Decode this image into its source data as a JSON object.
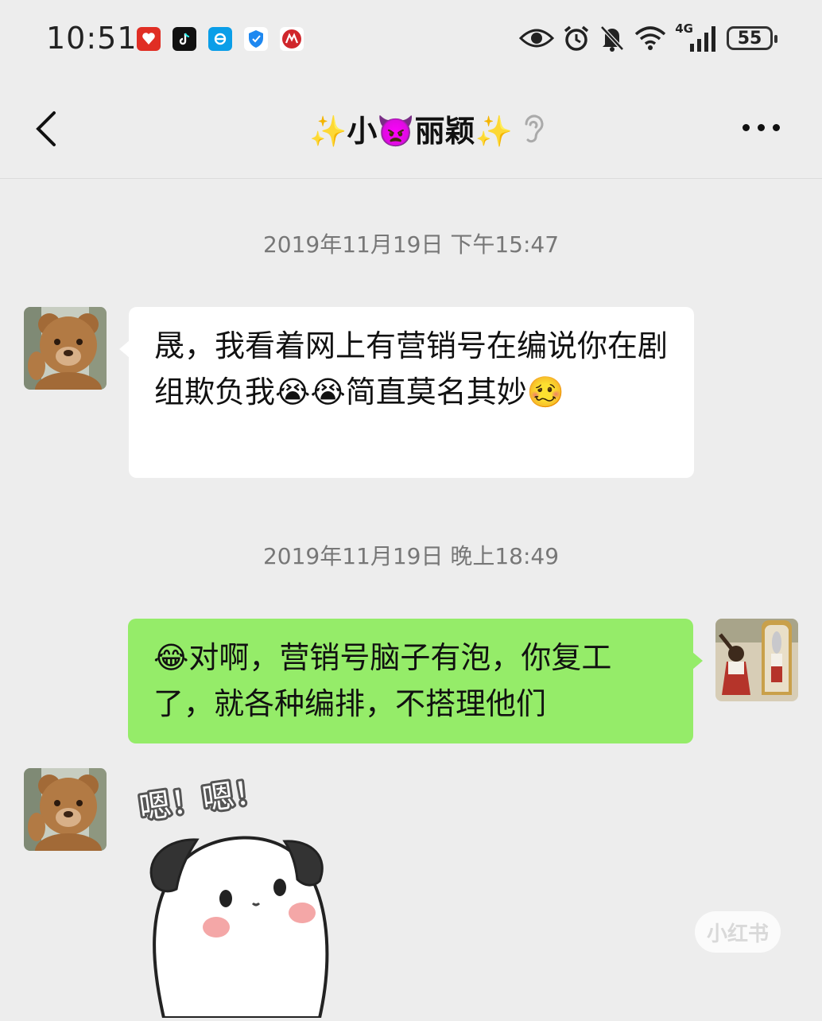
{
  "status_bar": {
    "time": "10:51",
    "network": "4G",
    "battery": "55",
    "app_icons": [
      "pinduoduo-icon",
      "tiktok-icon",
      "eleme-icon",
      "shield-icon",
      "bank-icon"
    ],
    "system_icons": [
      "eye-icon",
      "alarm-icon",
      "mute-icon",
      "wifi-icon",
      "signal-icon",
      "battery-icon"
    ]
  },
  "chat": {
    "title": "✨小👿丽颖✨"
  },
  "messages": [
    {
      "type": "timestamp",
      "text": "2019年11月19日 下午15:47"
    },
    {
      "type": "incoming",
      "text": "晟，我看着网上有营销号在编说你在剧组欺负我😭😭简直莫名其妙🥴"
    },
    {
      "type": "timestamp",
      "text": "2019年11月19日 晚上18:49"
    },
    {
      "type": "outgoing",
      "text": "😂对啊，营销号脑子有泡，你复工了，就各种编排，不搭理他们"
    },
    {
      "type": "sticker",
      "text": "嗯！嗯！"
    }
  ],
  "watermark": "小红书",
  "colors": {
    "background": "#ededed",
    "outgoing_bubble": "#95ec69",
    "incoming_bubble": "#ffffff"
  }
}
